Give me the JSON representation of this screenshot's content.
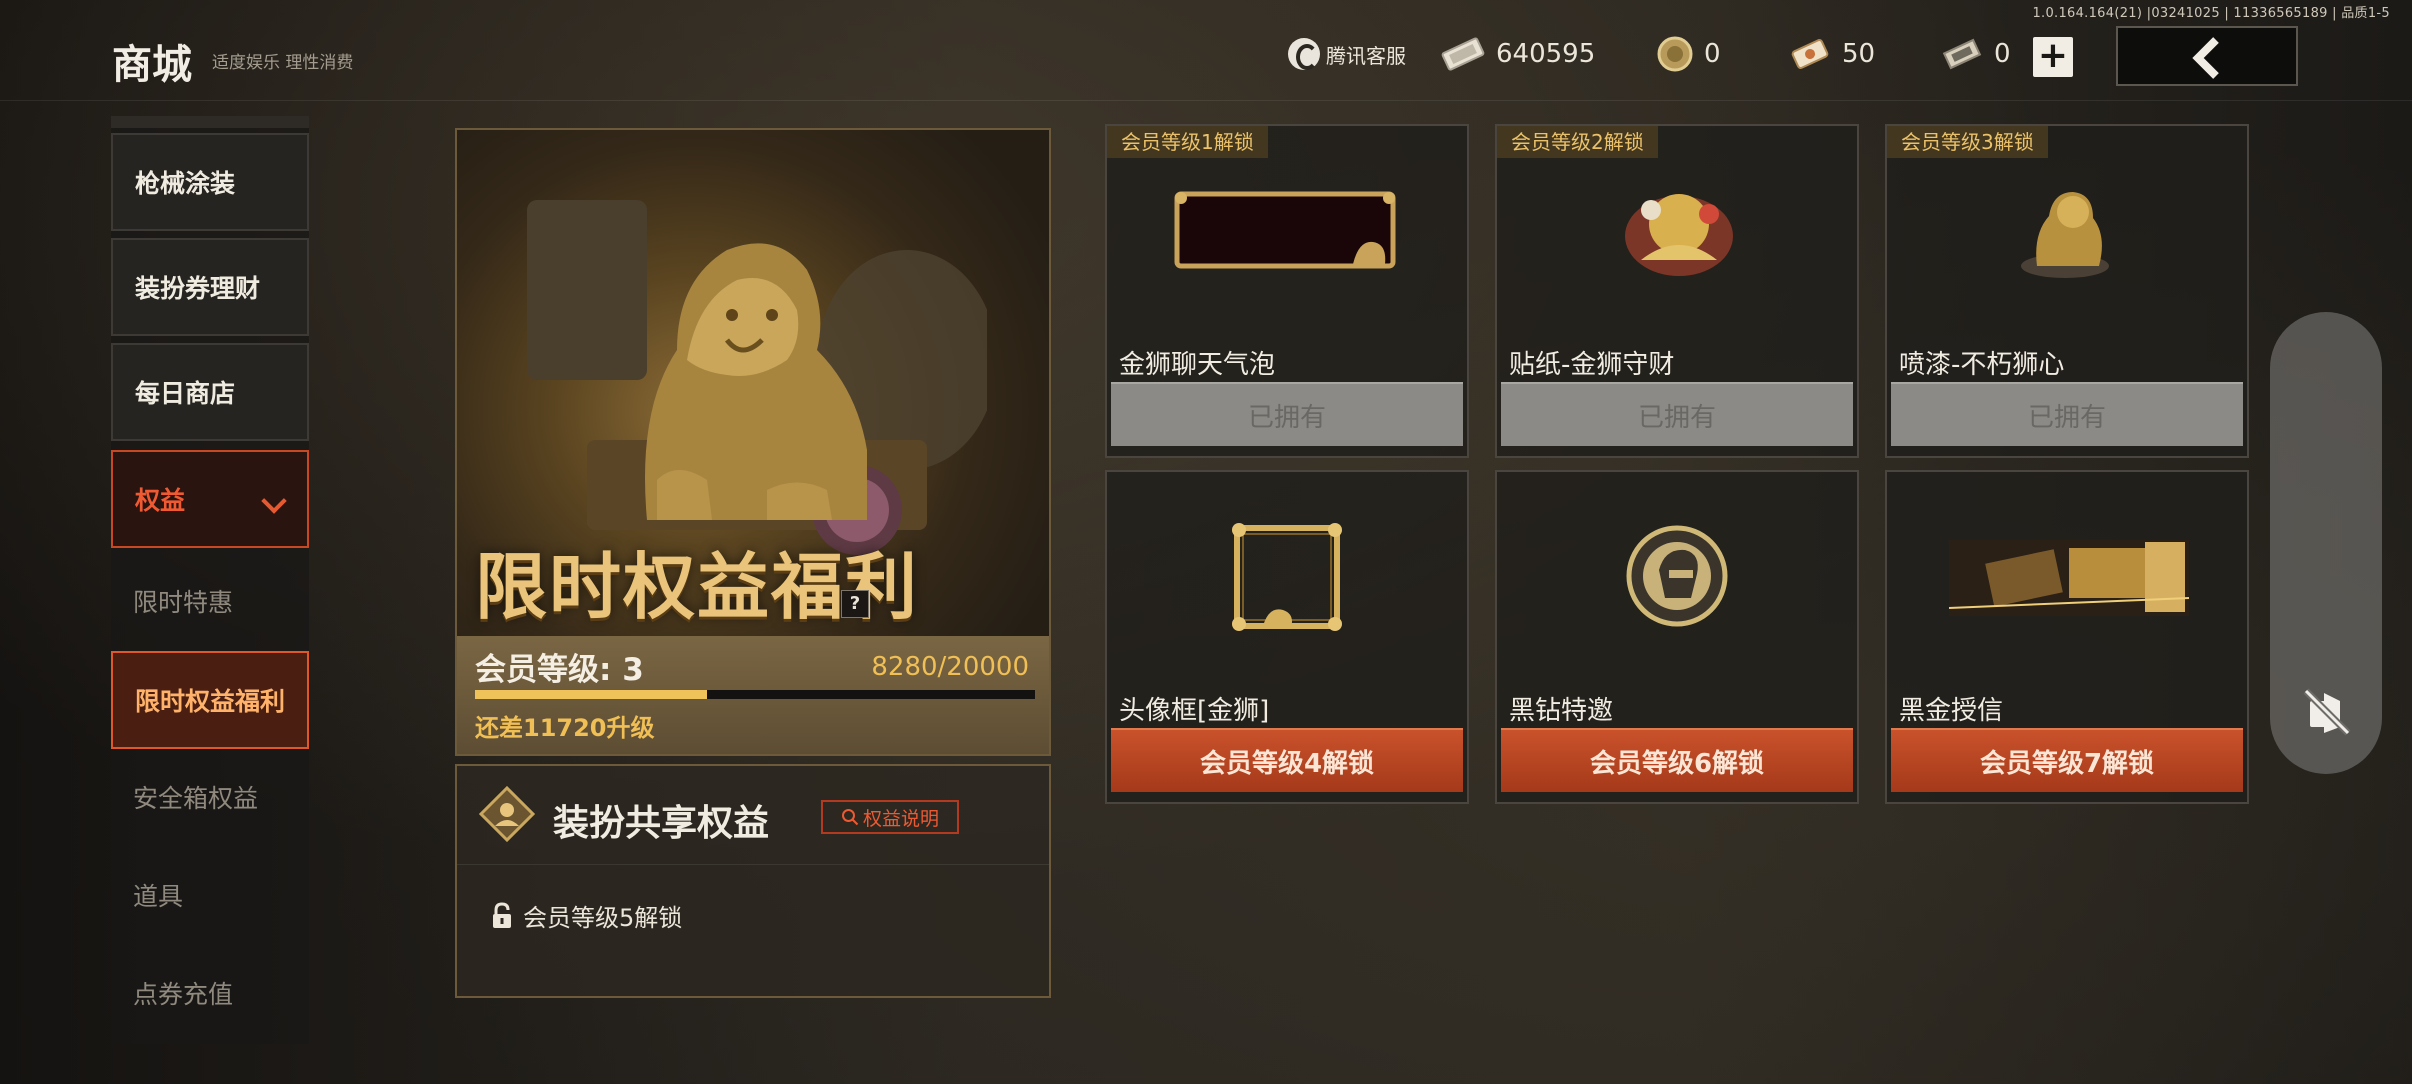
{
  "build_info": "1.0.164.164(21) |03241025 | 11336565189 | 品质1-5",
  "header": {
    "title": "商城",
    "subtitle": "适度娱乐 理性消费",
    "customer_service": "腾讯客服",
    "currencies": [
      {
        "icon": "cash-ticket-icon",
        "value": "640595"
      },
      {
        "icon": "gold-coin-icon",
        "value": "0"
      },
      {
        "icon": "voucher-icon",
        "value": "50"
      },
      {
        "icon": "point-ticket-icon",
        "value": "0"
      }
    ],
    "plus_label": "+",
    "back_icon": "chevron-left-icon"
  },
  "sidebar": {
    "items": [
      {
        "label": "枪械涂装"
      },
      {
        "label": "装扮券理财"
      },
      {
        "label": "每日商店"
      },
      {
        "label": "权益"
      }
    ],
    "sub_items": [
      {
        "label": "限时特惠"
      },
      {
        "label": "限时权益福利"
      },
      {
        "label": "安全箱权益"
      },
      {
        "label": "道具"
      },
      {
        "label": "点券充值"
      }
    ]
  },
  "banner": {
    "title": "限时权益福利",
    "help": "?",
    "level_label": "会员等级: 3",
    "progress_text": "8280/20000",
    "progress_fraction": 0.414,
    "remaining": "还差11720升级"
  },
  "share": {
    "title": "装扮共享权益",
    "rule_button": "权益说明",
    "lock_text": "会员等级5解锁"
  },
  "cards": [
    {
      "tag": "会员等级1解锁",
      "name": "金狮聊天气泡",
      "button": "已拥有",
      "state": "owned"
    },
    {
      "tag": "会员等级2解锁",
      "name": "贴纸-金狮守财",
      "button": "已拥有",
      "state": "owned"
    },
    {
      "tag": "会员等级3解锁",
      "name": "喷漆-不朽狮心",
      "button": "已拥有",
      "state": "owned"
    },
    {
      "tag": "",
      "name": "头像框[金狮]",
      "button": "会员等级4解锁",
      "state": "locked"
    },
    {
      "tag": "",
      "name": "黑钻特邀",
      "button": "会员等级6解锁",
      "state": "locked"
    },
    {
      "tag": "",
      "name": "黑金授信",
      "button": "会员等级7解锁",
      "state": "locked"
    }
  ],
  "colors": {
    "accent": "#e0582a",
    "gold": "#f0bf55",
    "owned_button": "#8c8a86"
  }
}
